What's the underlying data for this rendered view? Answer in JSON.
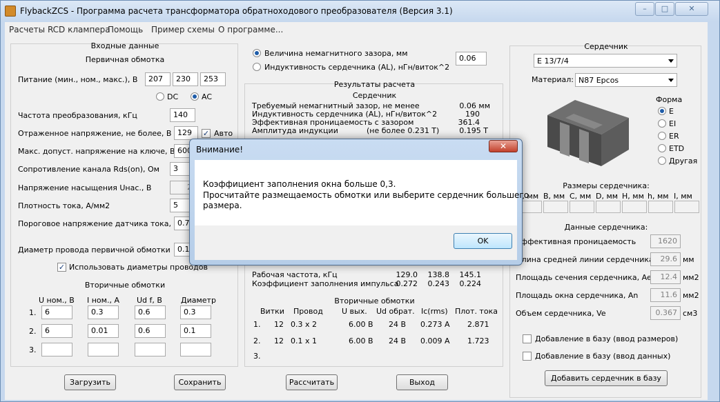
{
  "window": {
    "title": "FlybackZCS - Программа расчета трансформатора обратноходового преобразователя (Версия 3.1)",
    "controls": [
      "–",
      "□",
      "✕"
    ]
  },
  "menu": [
    "Расчеты RCD клампера",
    "Помощь",
    "Пример схемы",
    "О программе..."
  ],
  "input": {
    "section_title": "Входные данные",
    "primary_title": "Первичная обмотка",
    "supply_label": "Питание (мин., ном., макс.), В",
    "supply_values": [
      "207",
      "230",
      "253"
    ],
    "dc_label": "DC",
    "ac_label": "AC",
    "freq_label": "Частота преобразования, кГц",
    "freq_value": "140",
    "reflected_label": "Отраженное напряжение, не более, В",
    "reflected_value": "129",
    "auto_label": "Авто",
    "vmax_label": "Макс. допуст. напряжение на ключе, В",
    "vmax_value": "600",
    "rds_label": "Сопротивление канала Rds(on), Ом",
    "rds_value": "3",
    "usat_label": "Напряжение насыщения Uнас., В",
    "usat_value": "2",
    "jdens_label": "Плотность тока, А/мм2",
    "jdens_value": "5",
    "vsense_label": "Пороговое напряжение датчика тока, В",
    "vsense_value": "0.7",
    "wire_label": "Диаметр провода первичной обмотки",
    "wire_value": "0.1",
    "use_diam_label": "Использовать диаметры проводов",
    "secondary_title": "Вторичные обмотки",
    "sec_headers": [
      "U ном., В",
      "I ном., А",
      "Ud f, В",
      "Диаметр"
    ],
    "sec_rows": [
      {
        "n": "1.",
        "u": "6",
        "i": "0.3",
        "ud": "0.6",
        "d": "0.3"
      },
      {
        "n": "2.",
        "u": "6",
        "i": "0.01",
        "ud": "0.6",
        "d": "0.1"
      },
      {
        "n": "3.",
        "u": "",
        "i": "",
        "ud": "",
        "d": ""
      }
    ],
    "load_btn": "Загрузить",
    "save_btn": "Сохранить"
  },
  "middle": {
    "gap_radio_label": "Величина немагнитного зазора, мм",
    "al_radio_label": "Индуктивность сердечника (AL), нГн/виток^2",
    "gap_value": "0.06",
    "results_title": "Результаты расчета",
    "core_title": "Сердечник",
    "core_rows": [
      {
        "label": "Требуемый немагнитный зазор, не менее",
        "value": "0.06 мм"
      },
      {
        "label": "Индуктивность сердечника (AL), нГн/виток^2",
        "value": "190"
      },
      {
        "label": "Эффективная проницаемость с зазором",
        "value": "361.4"
      },
      {
        "label": "Амплитуда индукции",
        "note": "(не более 0.231 Т)",
        "value": "0.195 Т"
      }
    ],
    "op_rows": [
      {
        "label": "Рабочая частота, кГц",
        "v1": "129.0",
        "v2": "138.8",
        "v3": "145.1"
      },
      {
        "label": "Коэффициент заполнения импульса",
        "v1": "0.272",
        "v2": "0.243",
        "v3": "0.224"
      }
    ],
    "sec_title": "Вторичные обмотки",
    "sec_headers": [
      "Витки",
      "Провод",
      "U вых.",
      "Ud обрат.",
      "Ic(rms)",
      "Плот. тока"
    ],
    "sec_rows": [
      {
        "n": "1.",
        "turns": "12",
        "wire": "0.3 x 2",
        "u": "6.00 В",
        "ud": "24 В",
        "ic": "0.273 А",
        "j": "2.871"
      },
      {
        "n": "2.",
        "turns": "12",
        "wire": "0.1 x 1",
        "u": "6.00 В",
        "ud": "24 В",
        "ic": "0.009 А",
        "j": "1.723"
      },
      {
        "n": "3.",
        "turns": "",
        "wire": "",
        "u": "",
        "ud": "",
        "ic": "",
        "j": ""
      }
    ],
    "calc_btn": "Рассчитать",
    "exit_btn": "Выход"
  },
  "core": {
    "title": "Сердечник",
    "core_select": "E 13/7/4",
    "material_label": "Материал:",
    "material_select": "N87 Epcos",
    "shape_title": "Форма",
    "shapes": [
      {
        "label": "E",
        "checked": true
      },
      {
        "label": "EI",
        "checked": false
      },
      {
        "label": "ER",
        "checked": false
      },
      {
        "label": "ETD",
        "checked": false
      },
      {
        "label": "Другая",
        "checked": false
      }
    ],
    "dims_title": "Размеры сердечника:",
    "dims_headers": [
      "A, мм",
      "B, мм",
      "C, мм",
      "D, мм",
      "H, мм",
      "h, мм",
      "I, мм"
    ],
    "data_title": "Данные сердечника:",
    "mu_label": "Эффективная проницаемость",
    "mu_value": "1620",
    "le_label": "Длина средней линии сердечника, le",
    "le_value": "29.6",
    "le_unit": "мм",
    "ae_label": "Площадь сечения сердечника, Ae",
    "ae_value": "12.4",
    "ae_unit": "мм2",
    "an_label": "Площадь окна сердечника, An",
    "an_value": "11.6",
    "an_unit": "мм2",
    "ve_label": "Объем сердечника, Ve",
    "ve_value": "0.367",
    "ve_unit": "см3",
    "add_dims_label": "Добавление в базу (ввод размеров)",
    "add_data_label": "Добавление в базу (ввод данных)",
    "add_core_btn": "Добавить сердечник в базу"
  },
  "dialog": {
    "title": "Внимание!",
    "line1": "Коэффициент заполнения окна больше 0,3.",
    "line2": "Просчитайте размещаемость обмотки или выберите сердечник большего",
    "line3": "размера.",
    "ok_btn": "OK"
  }
}
